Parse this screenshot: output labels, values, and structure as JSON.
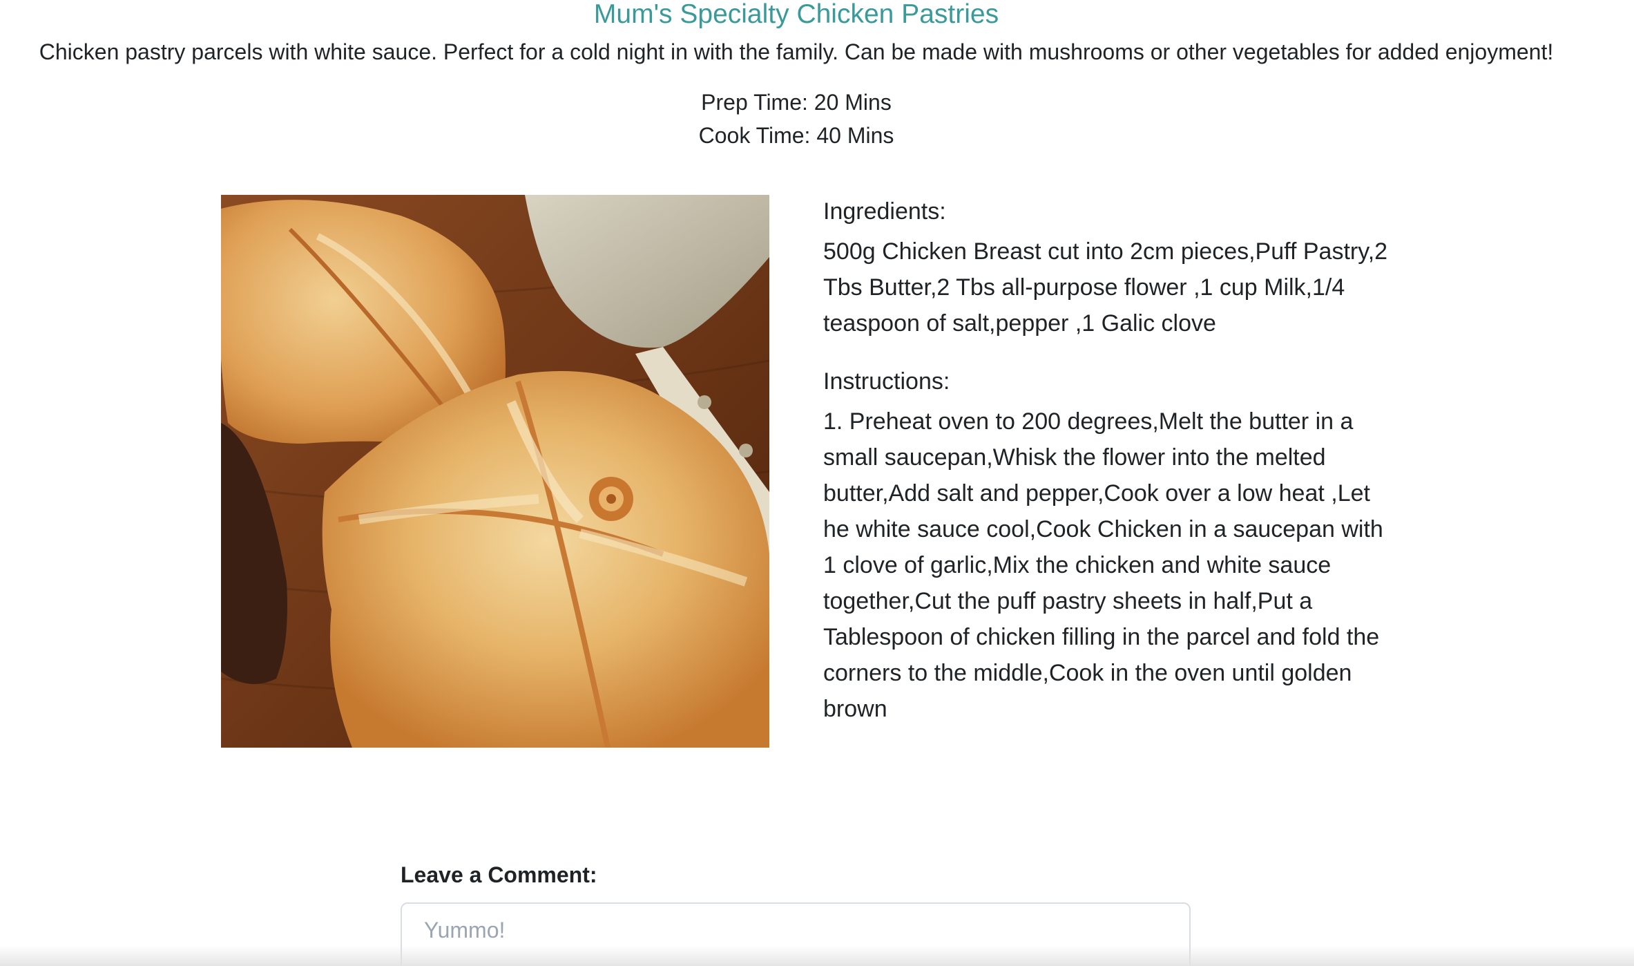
{
  "recipe": {
    "title": "Mum's Specialty Chicken Pastries",
    "description": "Chicken pastry parcels with white sauce. Perfect for a cold night in with the family. Can be made with mushrooms or other vegetables for added enjoyment!",
    "prep_time": "Prep Time: 20 Mins",
    "cook_time": "Cook Time: 40 Mins",
    "image_alt": "chicken pastry parcels photo",
    "ingredients_label": "Ingredients:",
    "ingredients": "500g Chicken Breast cut into 2cm pieces,Puff Pastry,2 Tbs Butter,2 Tbs all-purpose flower ,1 cup Milk,1/4 teaspoon of salt,pepper ,1 Galic clove",
    "instructions_label": "Instructions:",
    "instructions": "1. Preheat oven to 200 degrees,Melt the butter in a small saucepan,Whisk the flower into the melted butter,Add salt and pepper,Cook over a low heat ,Let he white sauce cool,Cook Chicken in a saucepan with 1 clove of garlic,Mix the chicken and white sauce together,Cut the puff pastry sheets in half,Put a Tablespoon of chicken filling in the parcel and fold the corners to the middle,Cook in the oven until golden brown"
  },
  "comment": {
    "label": "Leave a Comment:",
    "placeholder": "Yummo!",
    "value": ""
  },
  "colors": {
    "title": "#3a9a9a",
    "text": "#1f2326",
    "input_border": "#d8dde3",
    "placeholder": "#9aa5b1"
  }
}
